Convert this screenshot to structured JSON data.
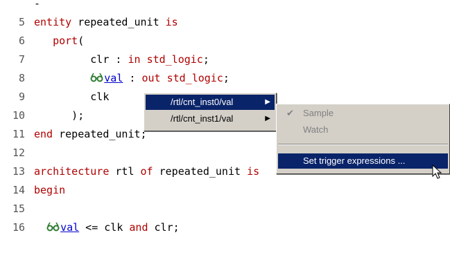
{
  "editor": {
    "lines": [
      {
        "num": "",
        "segments": [
          {
            "t": "-",
            "k": "plain"
          }
        ]
      },
      {
        "num": "5",
        "segments": [
          {
            "t": "entity",
            "k": "kw"
          },
          {
            "t": " repeated_unit ",
            "k": "plain"
          },
          {
            "t": "is",
            "k": "kw"
          }
        ]
      },
      {
        "num": "6",
        "segments": [
          {
            "t": "   ",
            "k": "plain"
          },
          {
            "t": "port",
            "k": "kw"
          },
          {
            "t": "(",
            "k": "plain"
          }
        ]
      },
      {
        "num": "7",
        "segments": [
          {
            "t": "         clr : ",
            "k": "plain"
          },
          {
            "t": "in",
            "k": "kw"
          },
          {
            "t": " ",
            "k": "plain"
          },
          {
            "t": "std_logic",
            "k": "kw"
          },
          {
            "t": ";",
            "k": "plain"
          }
        ]
      },
      {
        "num": "8",
        "segments": [
          {
            "t": "         ",
            "k": "plain"
          },
          {
            "t": "",
            "k": "icon"
          },
          {
            "t": "val",
            "k": "link"
          },
          {
            "t": " : ",
            "k": "plain"
          },
          {
            "t": "out",
            "k": "kw"
          },
          {
            "t": " ",
            "k": "plain"
          },
          {
            "t": "std_logic",
            "k": "kw"
          },
          {
            "t": ";",
            "k": "plain"
          }
        ]
      },
      {
        "num": "9",
        "segments": [
          {
            "t": "         clk",
            "k": "plain"
          }
        ]
      },
      {
        "num": "10",
        "segments": [
          {
            "t": "      );",
            "k": "plain"
          }
        ]
      },
      {
        "num": "11",
        "segments": [
          {
            "t": "end",
            "k": "kw"
          },
          {
            "t": " repeated_unit;",
            "k": "plain"
          }
        ]
      },
      {
        "num": "12",
        "segments": []
      },
      {
        "num": "13",
        "segments": [
          {
            "t": "architecture",
            "k": "kw"
          },
          {
            "t": " rtl ",
            "k": "plain"
          },
          {
            "t": "of",
            "k": "kw"
          },
          {
            "t": " repeated_unit ",
            "k": "plain"
          },
          {
            "t": "is",
            "k": "kw"
          }
        ]
      },
      {
        "num": "14",
        "segments": [
          {
            "t": "begin",
            "k": "kw"
          }
        ]
      },
      {
        "num": "15",
        "segments": []
      },
      {
        "num": "16",
        "segments": [
          {
            "t": "  ",
            "k": "plain"
          },
          {
            "t": "",
            "k": "icon"
          },
          {
            "t": "val",
            "k": "link"
          },
          {
            "t": " <= clk ",
            "k": "plain"
          },
          {
            "t": "and",
            "k": "kw"
          },
          {
            "t": " clr;",
            "k": "plain"
          }
        ]
      }
    ]
  },
  "context_menu": {
    "items": [
      {
        "label": "/rtl/cnt_inst0/val",
        "has_submenu": true,
        "selected": true
      },
      {
        "label": "/rtl/cnt_inst1/val",
        "has_submenu": true,
        "selected": false
      }
    ]
  },
  "submenu": {
    "sample_label": "Sample",
    "sample_checked": true,
    "watch_label": "Watch",
    "trigger_label": "Set trigger expressions ..."
  },
  "icons": {
    "probe": "glasses-icon",
    "submenu_arrow": "triangle-right-icon",
    "check": "checkmark-icon",
    "cursor": "mouse-pointer-icon"
  },
  "colors": {
    "keyword": "#b00000",
    "link": "#0000cc",
    "menu_bg": "#d4d0c8",
    "menu_highlight": "#0a246a",
    "disabled": "#808080",
    "probe_icon": "#2e7d32"
  }
}
